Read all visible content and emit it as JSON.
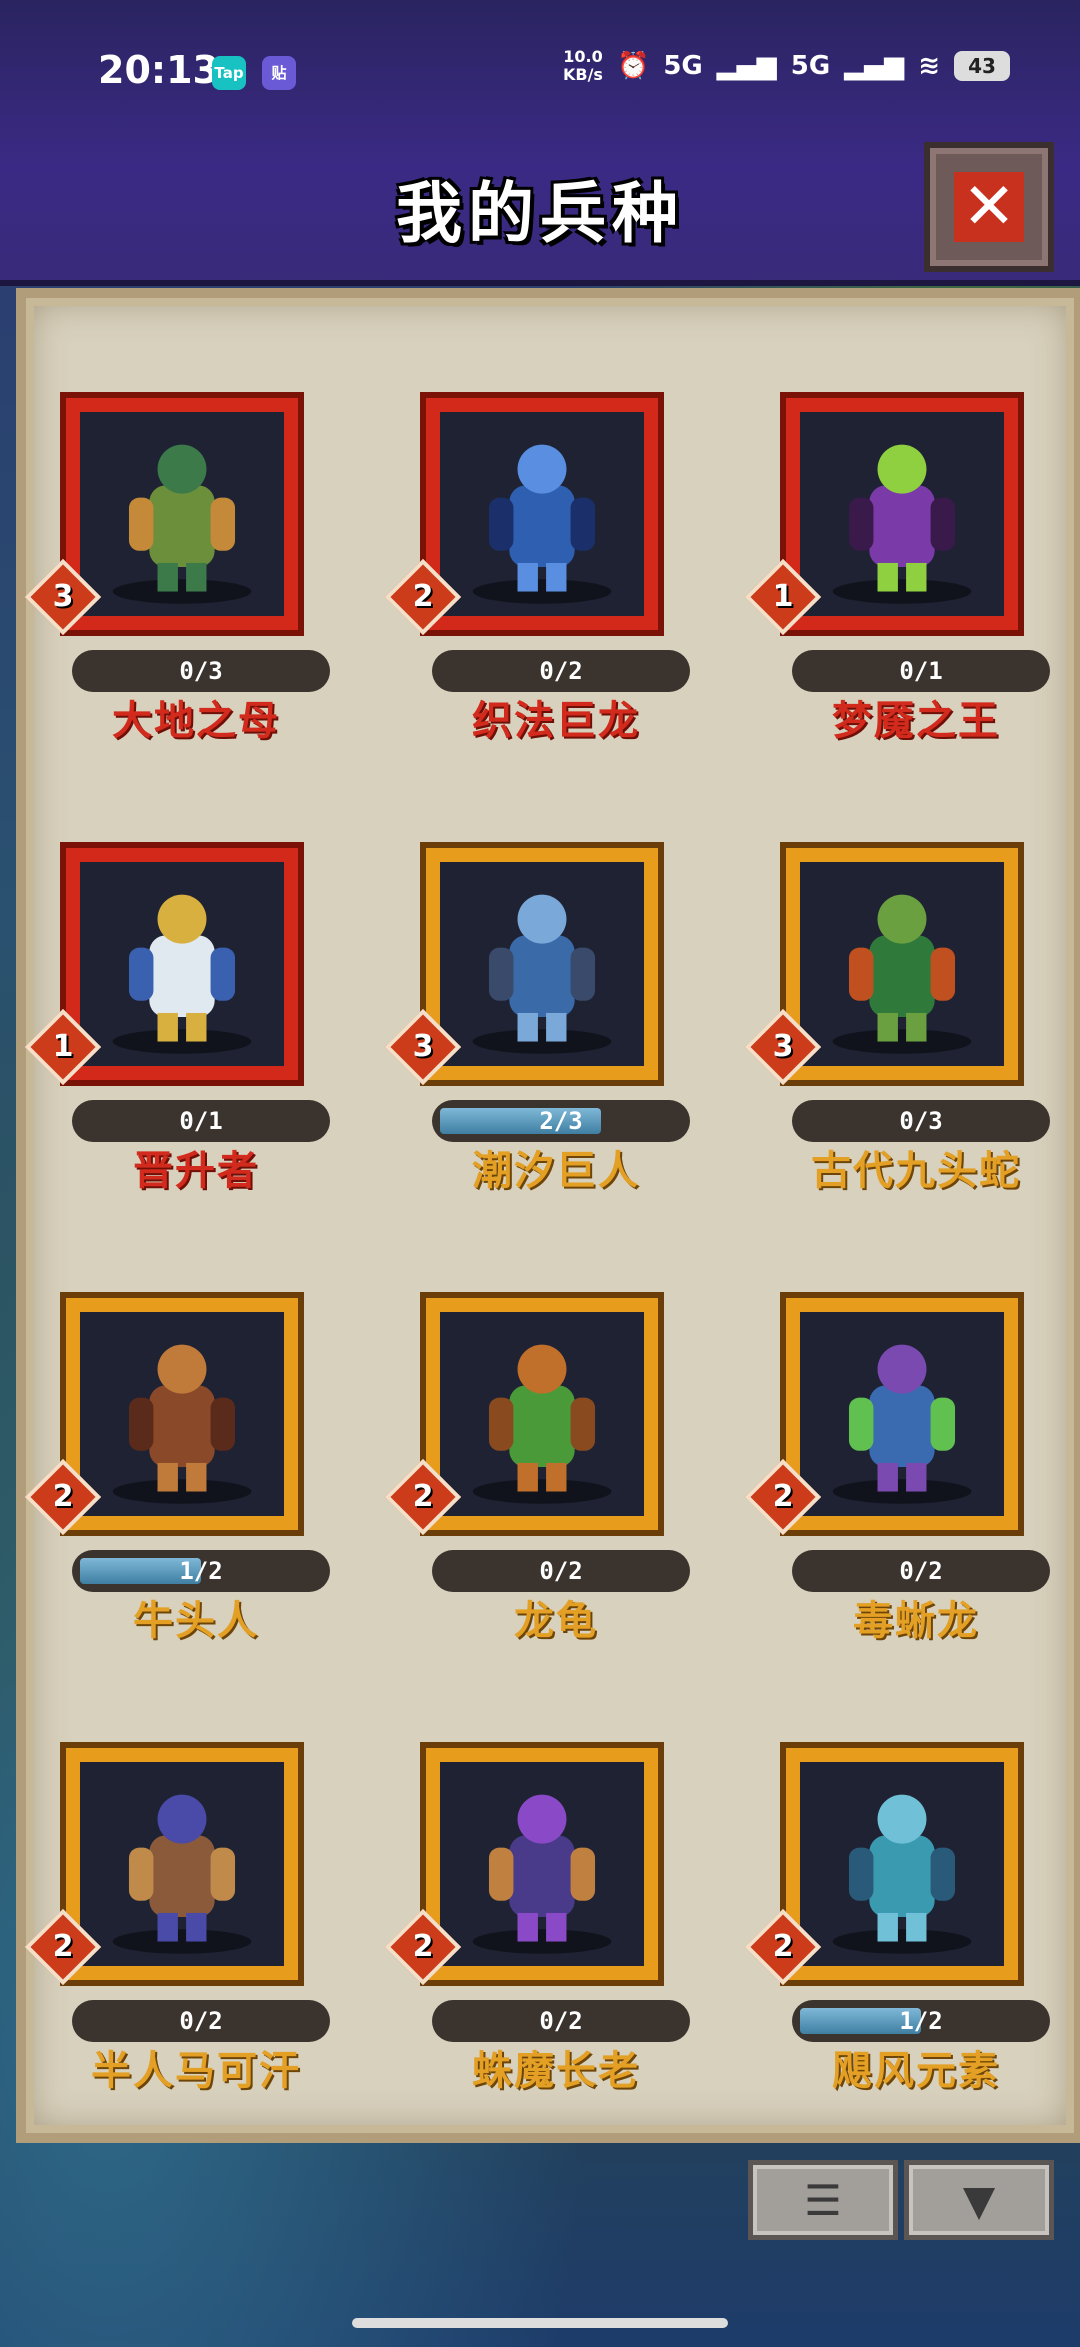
{
  "status": {
    "time": "20:13",
    "app_icon_tap": "Tap",
    "app_icon_tie": "贴",
    "net_speed_value": "10.0",
    "net_speed_unit": "KB/s",
    "signal_1": "5G",
    "signal_2": "5G",
    "battery": "43"
  },
  "header": {
    "title": "我的兵种",
    "close_icon": "close-icon"
  },
  "units": [
    {
      "name": "大地之母",
      "tier": "3",
      "progress": "0/3",
      "fill": 0,
      "frame": "red"
    },
    {
      "name": "织法巨龙",
      "tier": "2",
      "progress": "0/2",
      "fill": 0,
      "frame": "red"
    },
    {
      "name": "梦魇之王",
      "tier": "1",
      "progress": "0/1",
      "fill": 0,
      "frame": "red"
    },
    {
      "name": "晋升者",
      "tier": "1",
      "progress": "0/1",
      "fill": 0,
      "frame": "red"
    },
    {
      "name": "潮汐巨人",
      "tier": "3",
      "progress": "2/3",
      "fill": 0.667,
      "frame": "gold"
    },
    {
      "name": "古代九头蛇",
      "tier": "3",
      "progress": "0/3",
      "fill": 0,
      "frame": "gold"
    },
    {
      "name": "牛头人",
      "tier": "2",
      "progress": "1/2",
      "fill": 0.5,
      "frame": "gold"
    },
    {
      "name": "龙龟",
      "tier": "2",
      "progress": "0/2",
      "fill": 0,
      "frame": "gold"
    },
    {
      "name": "毒蜥龙",
      "tier": "2",
      "progress": "0/2",
      "fill": 0,
      "frame": "gold"
    },
    {
      "name": "半人马可汗",
      "tier": "2",
      "progress": "0/2",
      "fill": 0,
      "frame": "gold"
    },
    {
      "name": "蛛魔长老",
      "tier": "2",
      "progress": "0/2",
      "fill": 0,
      "frame": "gold"
    },
    {
      "name": "飓风元素",
      "tier": "2",
      "progress": "1/2",
      "fill": 0.5,
      "frame": "gold"
    }
  ],
  "toolbar": {
    "list_icon": "list-icon",
    "filter_icon": "filter-icon"
  },
  "colors": {
    "red_frame": "#d2291b",
    "gold_frame": "#e79c1c",
    "parchment": "#d8d1bd",
    "header_bg": "#3b2a85"
  }
}
